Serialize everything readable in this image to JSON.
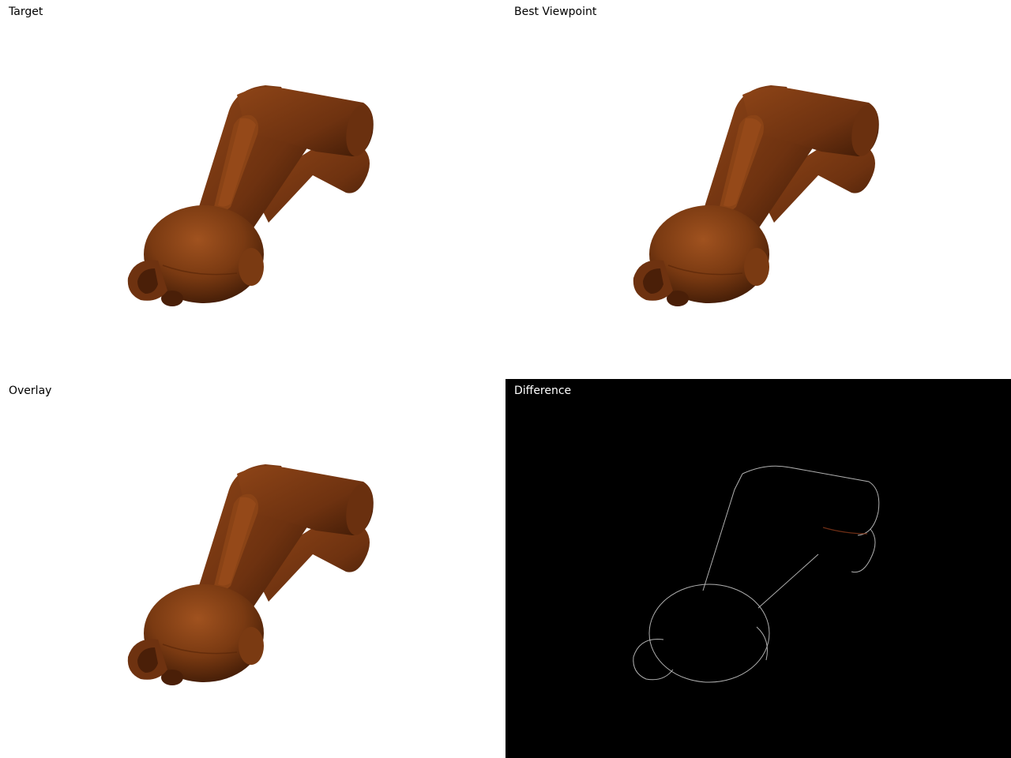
{
  "panels": {
    "target": {
      "label": "Target"
    },
    "best_viewpoint": {
      "label": "Best Viewpoint"
    },
    "overlay": {
      "label": "Overlay"
    },
    "difference": {
      "label": "Difference"
    }
  },
  "colors": {
    "model_base": "#7a3a12",
    "model_shadow": "#3e1a06",
    "model_highlight": "#a0521f",
    "diff_background": "#000000",
    "diff_edge": "#cfcfcf",
    "panel_background": "#ffffff"
  }
}
